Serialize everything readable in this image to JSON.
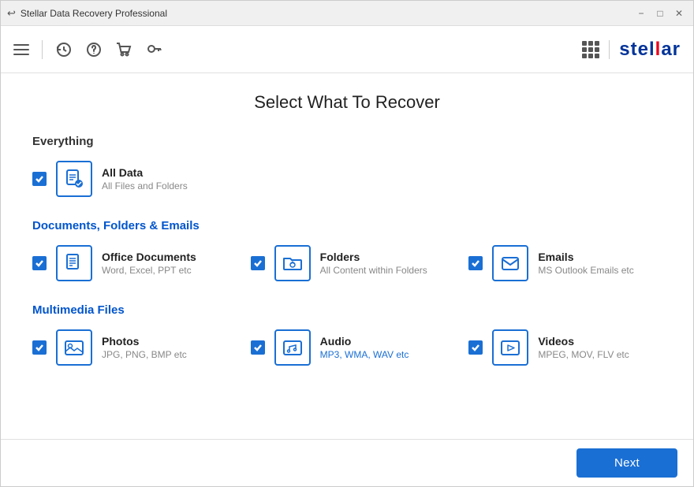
{
  "titleBar": {
    "title": "Stellar Data Recovery Professional",
    "backIcon": "↩",
    "minLabel": "−",
    "maxLabel": "□",
    "closeLabel": "✕"
  },
  "toolbar": {
    "icons": [
      "hamburger",
      "history",
      "help",
      "cart",
      "key"
    ],
    "logoText": "stel",
    "logoHighlight": "l",
    "logoRest": "ar"
  },
  "page": {
    "title": "Select What To Recover"
  },
  "sections": [
    {
      "id": "everything",
      "title": "Everything",
      "items": [
        {
          "id": "all-data",
          "label": "All Data",
          "sublabel": "All Files and Folders",
          "sublabelClass": "",
          "checked": true,
          "iconType": "document"
        }
      ]
    },
    {
      "id": "documents",
      "title": "Documents, Folders & Emails",
      "titleClass": "blue",
      "items": [
        {
          "id": "office-docs",
          "label": "Office Documents",
          "sublabel": "Word, Excel, PPT etc",
          "sublabelClass": "",
          "checked": true,
          "iconType": "officedoc"
        },
        {
          "id": "folders",
          "label": "Folders",
          "sublabel": "All Content within Folders",
          "sublabelClass": "",
          "checked": true,
          "iconType": "folder"
        },
        {
          "id": "emails",
          "label": "Emails",
          "sublabel": "MS Outlook Emails etc",
          "sublabelClass": "",
          "checked": true,
          "iconType": "email"
        }
      ]
    },
    {
      "id": "multimedia",
      "title": "Multimedia Files",
      "titleClass": "blue",
      "items": [
        {
          "id": "photos",
          "label": "Photos",
          "sublabel": "JPG, PNG, BMP etc",
          "sublabelClass": "",
          "checked": true,
          "iconType": "photo"
        },
        {
          "id": "audio",
          "label": "Audio",
          "sublabel": "MP3, WMA, WAV etc",
          "sublabelClass": "blue",
          "checked": true,
          "iconType": "audio"
        },
        {
          "id": "videos",
          "label": "Videos",
          "sublabel": "MPEG, MOV, FLV etc",
          "sublabelClass": "",
          "checked": true,
          "iconType": "video"
        }
      ]
    }
  ],
  "footer": {
    "nextLabel": "Next"
  }
}
